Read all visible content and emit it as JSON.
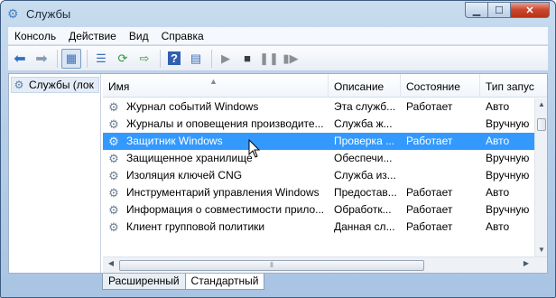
{
  "window": {
    "title": "Службы",
    "app_icon": "gear-icon"
  },
  "menu": [
    "Консоль",
    "Действие",
    "Вид",
    "Справка"
  ],
  "toolbar": {
    "buttons": [
      {
        "name": "back",
        "icon": "arrow-left-icon"
      },
      {
        "name": "forward",
        "icon": "arrow-right-icon"
      },
      {
        "name": "show-tree",
        "icon": "console-tree-icon"
      },
      {
        "name": "export-list",
        "icon": "list-icon"
      },
      {
        "name": "refresh",
        "icon": "refresh-icon"
      },
      {
        "name": "export",
        "icon": "export-icon"
      },
      {
        "name": "help",
        "icon": "help-icon"
      },
      {
        "name": "properties",
        "icon": "properties-icon"
      },
      {
        "name": "start",
        "icon": "play-icon"
      },
      {
        "name": "stop",
        "icon": "stop-icon"
      },
      {
        "name": "pause",
        "icon": "pause-icon"
      },
      {
        "name": "restart",
        "icon": "restart-icon"
      }
    ]
  },
  "tree": {
    "item": "Службы (лок"
  },
  "columns": {
    "name": "Имя",
    "description": "Описание",
    "state": "Состояние",
    "start_type": "Тип запус"
  },
  "services": [
    {
      "name": "Журнал событий Windows",
      "description": "Эта служб...",
      "state": "Работает",
      "start_type": "Авто"
    },
    {
      "name": "Журналы и оповещения производите...",
      "description": "Служба ж...",
      "state": "",
      "start_type": "Вручную"
    },
    {
      "name": "Защитник Windows",
      "description": "Проверка ...",
      "state": "Работает",
      "start_type": "Авто"
    },
    {
      "name": "Защищенное хранилище",
      "description": "Обеспечи...",
      "state": "",
      "start_type": "Вручную"
    },
    {
      "name": "Изоляция ключей CNG",
      "description": "Служба из...",
      "state": "",
      "start_type": "Вручную"
    },
    {
      "name": "Инструментарий управления Windows",
      "description": "Предостав...",
      "state": "Работает",
      "start_type": "Авто"
    },
    {
      "name": "Информация о совместимости прило...",
      "description": "Обработк...",
      "state": "Работает",
      "start_type": "Вручную"
    },
    {
      "name": "Клиент групповой политики",
      "description": "Данная сл...",
      "state": "Работает",
      "start_type": "Авто"
    }
  ],
  "selected_index": 2,
  "tabs": [
    "Расширенный",
    "Стандартный"
  ],
  "colors": {
    "selection": "#3399ff",
    "frame": "#b7cfe9"
  }
}
